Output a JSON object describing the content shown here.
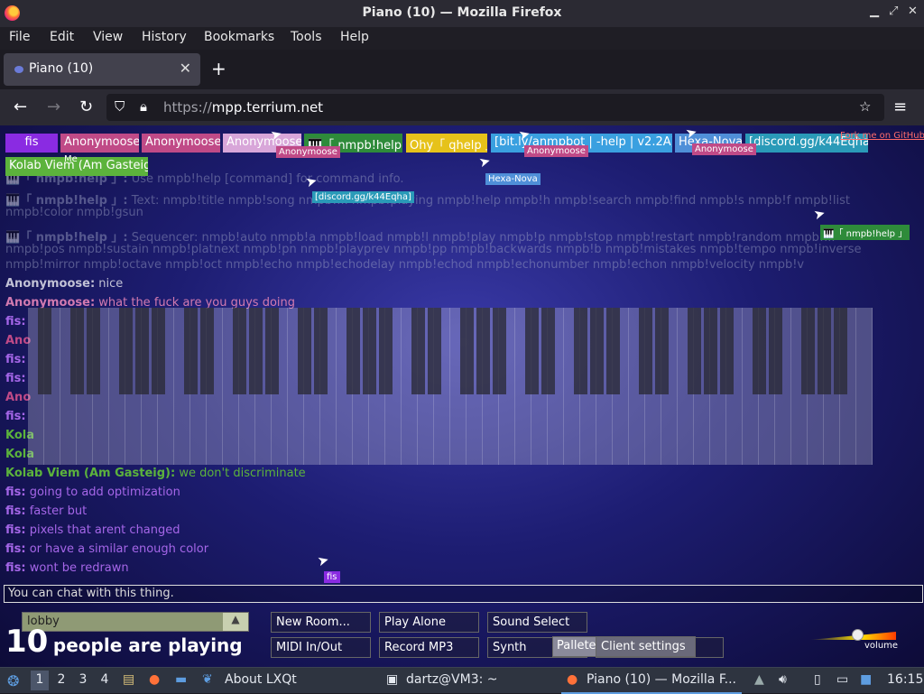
{
  "window": {
    "title": "Piano (10) — Mozilla Firefox"
  },
  "menu": [
    "File",
    "Edit",
    "View",
    "History",
    "Bookmarks",
    "Tools",
    "Help"
  ],
  "tab": {
    "title": "Piano (10)"
  },
  "url": {
    "scheme": "https://",
    "host": "mpp.terrium.net"
  },
  "users": [
    {
      "label": "fis",
      "color": "#8a2be2"
    },
    {
      "label": "Anonymoose",
      "color": "#c04a87"
    },
    {
      "label": "Anonymoose",
      "color": "#c04a87"
    },
    {
      "label": "Anonymoose",
      "color": "#d8a6d9"
    },
    {
      "label": "🎹「 nmpb!help 」",
      "color": "#2e8b3a"
    },
    {
      "label": "Ohy「 qhelp 」",
      "color": "#e6c21a"
    },
    {
      "label": "[bit.ly/anmpbot | -help | v2.2A]",
      "color": "#3aa0e0"
    },
    {
      "label": "Hexa-Nova",
      "color": "#4f8fd8"
    },
    {
      "label": "[discord.gg/k44Eqha]",
      "color": "#2a9ab8"
    },
    {
      "label": "Kolab Viem (Am Gasteig)",
      "color": "#5cb33c"
    }
  ],
  "user_me_tag": "Me",
  "github_link": "Fork me on GitHub",
  "cursor_tags": [
    {
      "label": "Anonymoose",
      "color": "#c04a87"
    },
    {
      "label": "Anonymoose",
      "color": "#c04a87"
    },
    {
      "label": "Anonymoose",
      "color": "#c04a87"
    },
    {
      "label": "Hexa-Nova",
      "color": "#4f8fd8"
    },
    {
      "label": "[discord.gg/k44Eqha]",
      "color": "#2a9ab8"
    },
    {
      "label": "🎹「 nmpb!help 」",
      "color": "#2e8b3a"
    },
    {
      "label": "fis",
      "color": "#8a2be2"
    }
  ],
  "chat": {
    "line0": {
      "name": "🎹「 nmpb!help 」:",
      "text": "Use nmpb!help [command] for command info.",
      "color": "#a0a6c8"
    },
    "line1": {
      "name": "🎹「 nmpb!help 」:",
      "text": "Text: nmpb!title nmpb!song nmpb!... nmpb!playing nmpb!help nmpb!h nmpb!search nmpb!find nmpb!s nmpb!f nmpb!list",
      "cont": "nmpb!color nmpb!gsun",
      "color": "#a0a6c8"
    },
    "line2": {
      "name": "🎹「 nmpb!help 」:",
      "text": "Sequencer: nmpb!auto nmpb!a nmpb!load nmpb!l nmpb!play nmpb!p nmpb!stop nmpb!restart nmpb!random nmpb!...",
      "cont": "nmpb!pos nmpb!sustain nmpb!platnext nmpb!pn nmpb!playprev nmpb!pp nmpb!backwards nmpb!b nmpb!mistakes nmpb!tempo nmpb!inverse",
      "cont2": "nmpb!mirror nmpb!octave nmpb!oct nmpb!echo nmpb!echodelay nmpb!echod nmpb!echonumber nmpb!echon nmpb!velocity nmpb!v",
      "color": "#a0a6c8"
    },
    "line3": {
      "name": "Anonymoose:",
      "text": "nice",
      "color": "#c2c2d6"
    },
    "line4": {
      "name": "Anonymoose:",
      "text": "what the fuck are you guys doing",
      "color": "#d27ab0"
    },
    "line5": {
      "name": "fis:",
      "text": "",
      "color": "#a566e8"
    },
    "line6": {
      "name": "Ano",
      "text": "",
      "color": "#c04a87"
    },
    "line7": {
      "name": "fis:",
      "text": "",
      "color": "#a566e8"
    },
    "line8": {
      "name": "fis:",
      "text": "",
      "color": "#a566e8"
    },
    "line9": {
      "name": "Ano",
      "text": "",
      "color": "#c04a87"
    },
    "line10": {
      "name": "fis:",
      "text": "",
      "color": "#a566e8"
    },
    "line11": {
      "name": "Kola",
      "text": "",
      "color": "#5cb33c"
    },
    "line12": {
      "name": "Kola",
      "text": "",
      "color": "#5cb33c"
    },
    "line13": {
      "name": "Kolab Viem (Am Gasteig):",
      "text": "we don't discriminate",
      "color": "#5cb33c"
    },
    "line14": {
      "name": "fis:",
      "text": "going to add optimization",
      "color": "#a566e8"
    },
    "line15": {
      "name": "fis:",
      "text": "faster but",
      "color": "#a566e8"
    },
    "line16": {
      "name": "fis:",
      "text": "pixels that arent changed",
      "color": "#a566e8"
    },
    "line17": {
      "name": "fis:",
      "text": "or have a similar enough color",
      "color": "#a566e8"
    },
    "line18": {
      "name": "fis:",
      "text": "wont be redrawn",
      "color": "#a566e8"
    }
  },
  "chat_input": {
    "placeholder": "You can chat with this thing."
  },
  "room": {
    "name": "lobby"
  },
  "players": {
    "count": "10",
    "text": "people are playing"
  },
  "buttons": {
    "new_room": "New Room...",
    "play_alone": "Play Alone",
    "sound_select": "Sound Select",
    "midi": "MIDI In/Out",
    "record": "Record MP3",
    "synth": "Synth",
    "pallete": "Pallete",
    "client_settings": "Client settings"
  },
  "volume": {
    "label": "volume",
    "level": 0.55
  },
  "taskbar": {
    "desktops": [
      "1",
      "2",
      "3",
      "4"
    ],
    "about": "About LXQt",
    "terminal": "dartz@VM3: ~",
    "firefox": "Piano (10) — Mozilla F...",
    "clock": "16:15"
  }
}
